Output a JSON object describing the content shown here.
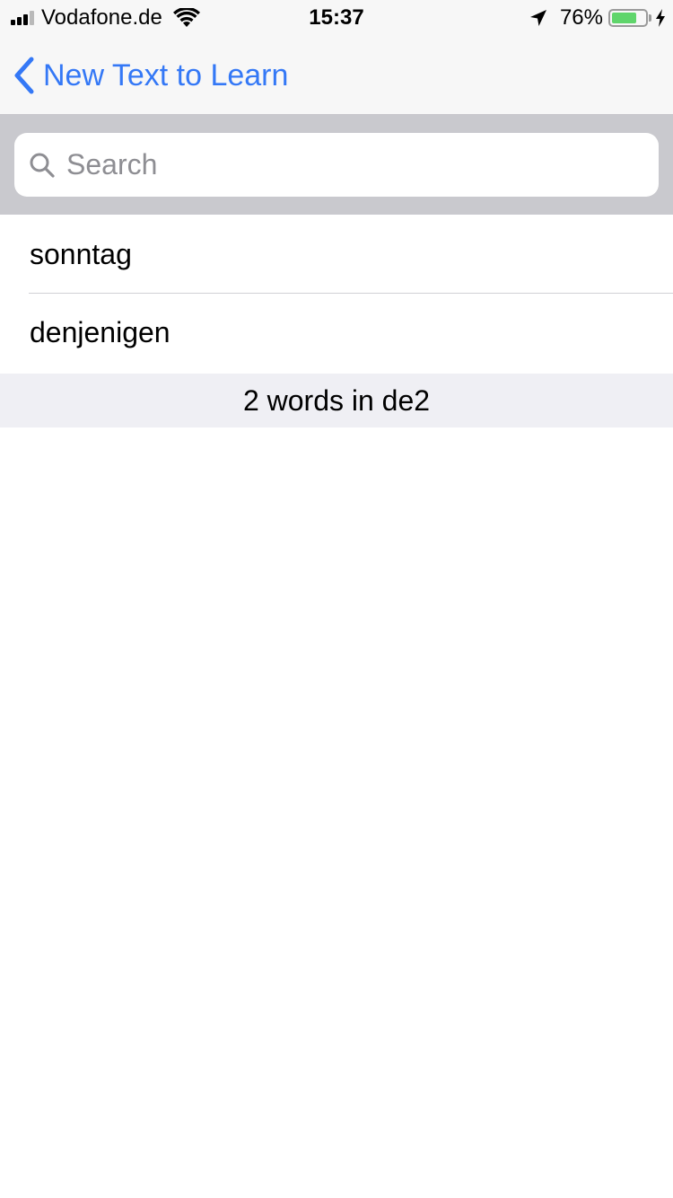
{
  "status_bar": {
    "carrier": "Vodafone.de",
    "time": "15:37",
    "battery_percent": "76%",
    "battery_level": 0.76,
    "signal_bars_filled": 3,
    "signal_bars_total": 4,
    "battery_color": "#5fd56b"
  },
  "nav": {
    "back_label": "New Text to Learn",
    "accent_color": "#3478f6"
  },
  "search": {
    "placeholder": "Search",
    "value": ""
  },
  "words": [
    {
      "label": "sonntag"
    },
    {
      "label": "denjenigen"
    }
  ],
  "footer": {
    "summary": "2 words in de2"
  }
}
